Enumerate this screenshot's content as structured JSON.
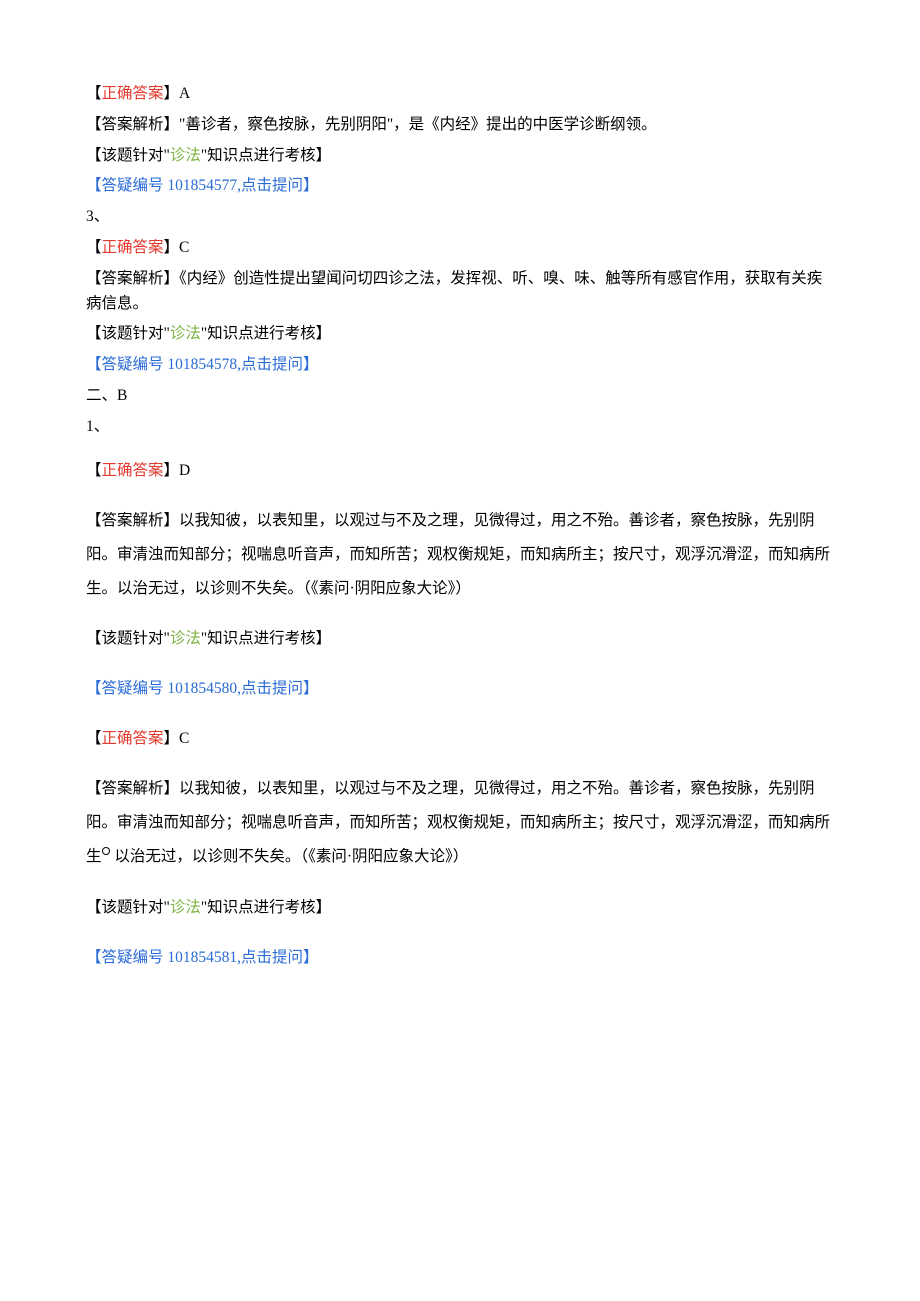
{
  "block1": {
    "correct_label": "【",
    "correct_text": "正确答案",
    "correct_close": "】A",
    "analysis": "【答案解析】\"善诊者，察色按脉，先别阴阳\"，是《内经》提出的中医学诊断纲领。",
    "topic_pre": "【该题针对\"",
    "topic_green": "诊法",
    "topic_post": "\"知识点进行考核】",
    "doubt": "【答疑编号 101854577,点击提问】"
  },
  "sep1": "3、",
  "block2": {
    "correct_label": "【",
    "correct_text": "正确答案",
    "correct_close": "】C",
    "analysis": "【答案解析】《内经》创造性提出望闻问切四诊之法，发挥视、听、嗅、味、触等所有感官作用，获取有关疾病信息。",
    "topic_pre": "【该题针对\"",
    "topic_green": "诊法",
    "topic_post": "\"知识点进行考核】",
    "doubt": "【答疑编号 101854578,点击提问】"
  },
  "sep2": "二、B",
  "sep3": "1、",
  "block3": {
    "correct_label": "【",
    "correct_text": "正确答案",
    "correct_close": "】D",
    "analysis": "【答案解析】以我知彼，以表知里，以观过与不及之理，见微得过，用之不殆。善诊者，察色按脉，先别阴阳。审清浊而知部分；视喘息听音声，而知所苦；观权衡规矩，而知病所主；按尺寸，观浮沉滑涩，而知病所生。以治无过，以诊则不失矣。（《素问·阴阳应象大论》）",
    "topic_pre": "【该题针对\"",
    "topic_green": "诊法",
    "topic_post": "\"知识点进行考核】",
    "doubt": "【答疑编号 101854580,点击提问】"
  },
  "block4": {
    "correct_label": "【",
    "correct_text": "正确答案",
    "correct_close": "】C",
    "analysis_a": "【答案解析】以我知彼，以表知里，以观过与不及之理，见微得过，用之不殆。善诊者，察色按脉，先别阴阳。审清浊而知部分；视喘息听音声，而知所苦；观权衡规矩，而知病所主；按尺寸，观浮沉滑涩，而知病所生",
    "analysis_b": "以治无过，以诊则不失矣。（《素问·阴阳应象大论》）",
    "topic_pre": "【该题针对\"",
    "topic_green": "诊法",
    "topic_post": "\"知识点进行考核】",
    "doubt": "【答疑编号 101854581,点击提问】"
  }
}
